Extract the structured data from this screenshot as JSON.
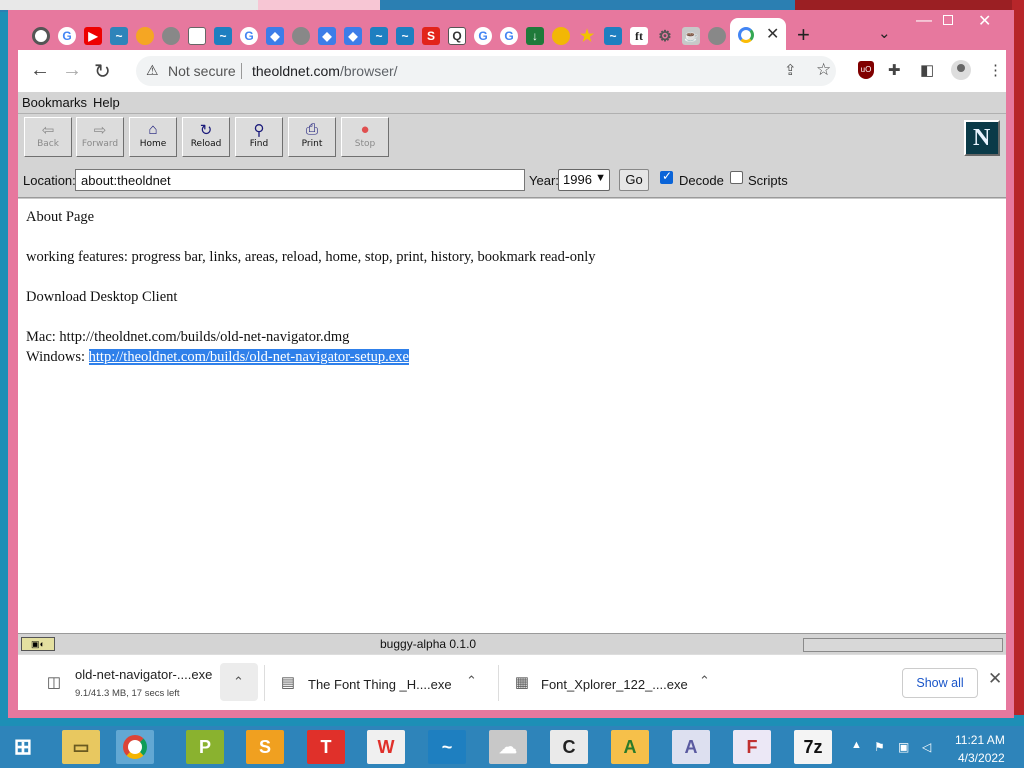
{
  "browser": {
    "active_tab_close": "✕",
    "new_tab": "+",
    "omnibox": {
      "security_label": "Not secure",
      "url_host": "theoldnet.com",
      "url_path": "/browser/"
    }
  },
  "app": {
    "menu": [
      "Bookmarks",
      "Help"
    ],
    "toolbar": {
      "back": "Back",
      "forward": "Forward",
      "home": "Home",
      "reload": "Reload",
      "find": "Find",
      "print": "Print",
      "stop": "Stop"
    },
    "logo_letter": "N",
    "location": {
      "label": "Location:",
      "value": "about:theoldnet",
      "year_label": "Year:",
      "year_value": "1996",
      "go_label": "Go",
      "decode_label": "Decode",
      "decode_checked": true,
      "scripts_label": "Scripts",
      "scripts_checked": false
    },
    "content": {
      "heading": "About Page",
      "features": "working features: progress bar, links, areas, reload, home, stop, print, history, bookmark read-only",
      "download_heading": "Download Desktop Client",
      "mac_label": "Mac: ",
      "mac_link": "http://theoldnet.com/builds/old-net-navigator.dmg",
      "windows_label": "Windows: ",
      "windows_link": "http://theoldnet.com/builds/old-net-navigator-setup.exe"
    },
    "status": {
      "text": "buggy-alpha 0.1.0",
      "progress": 0
    }
  },
  "downloads": {
    "items": [
      {
        "name": "old-net-navigator-....exe",
        "detail": "9.1/41.3 MB, 17 secs left"
      },
      {
        "name": "The Font Thing _H....exe"
      },
      {
        "name": "Font_Xplorer_122_....exe"
      }
    ],
    "show_all": "Show all"
  },
  "taskbar": {
    "clock_time": "11:21 AM",
    "clock_date": "4/3/2022"
  },
  "colors": {
    "window_frame": "#e7789e",
    "selection": "#2f80ea",
    "taskbar": "#2e84ba"
  }
}
